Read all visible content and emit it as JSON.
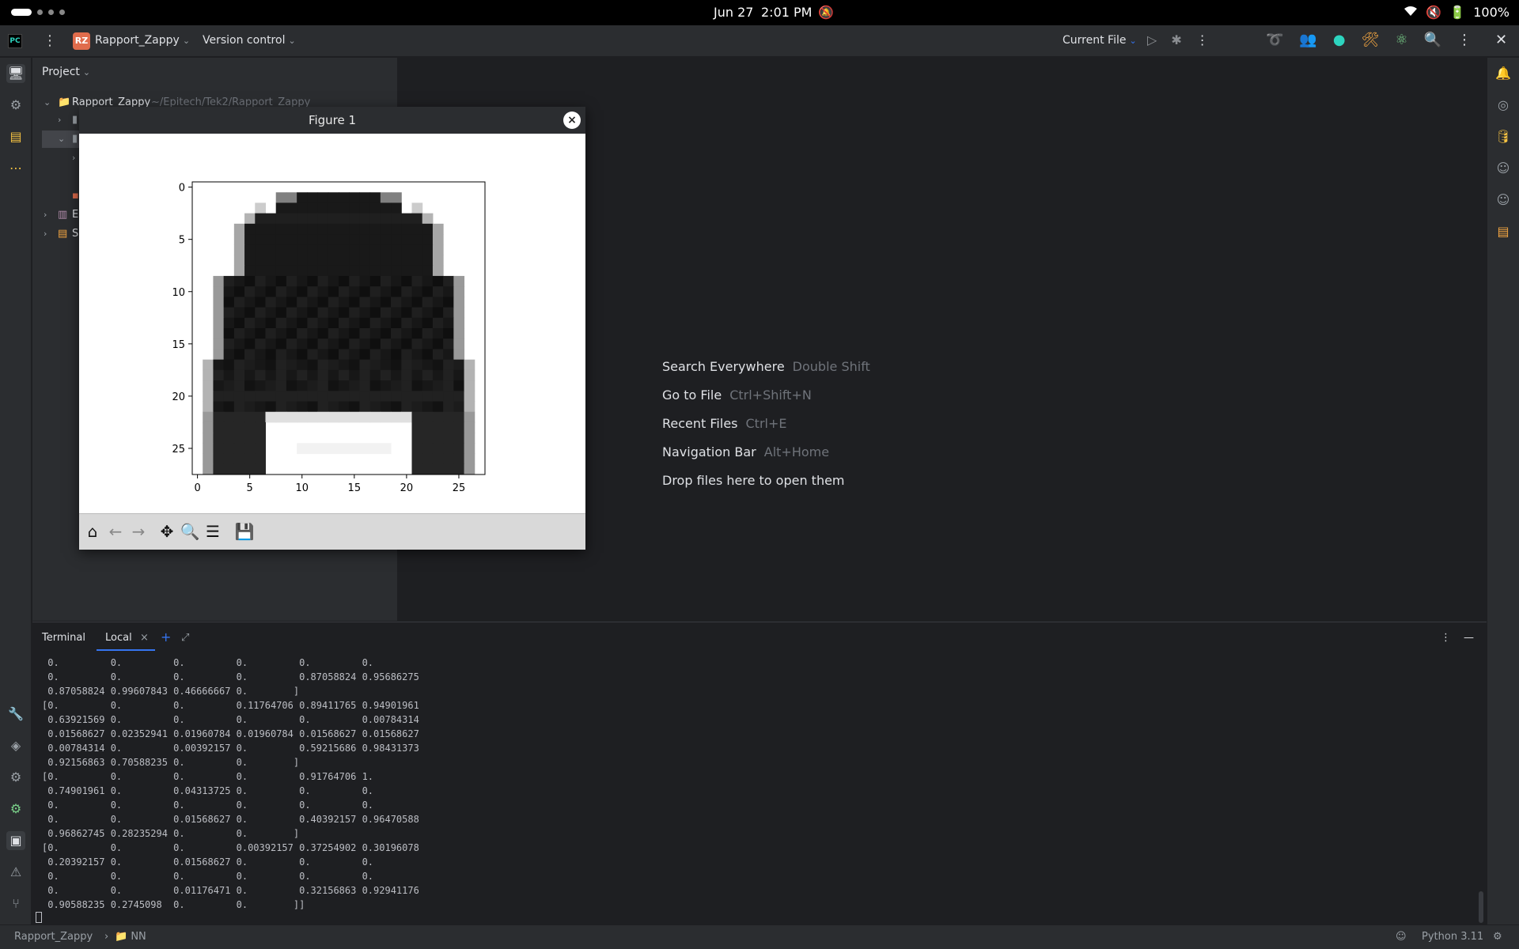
{
  "system": {
    "date": "Jun 27",
    "time": "2:01 PM",
    "battery": "100%"
  },
  "titlebar": {
    "project_badge": "RZ",
    "project_name": "Rapport_Zappy",
    "vcs": "Version control",
    "run_config": "Current File"
  },
  "project_panel": {
    "title": "Project",
    "root_name": "Rapport_Zappy",
    "root_path": "~/Epitech/Tek2/Rapport_Zappy",
    "row_e": "E",
    "row_s": "S"
  },
  "welcome": {
    "items": [
      {
        "label": "Search Everywhere",
        "shortcut": "Double Shift"
      },
      {
        "label": "Go to File",
        "shortcut": "Ctrl+Shift+N"
      },
      {
        "label": "Recent Files",
        "shortcut": "Ctrl+E"
      },
      {
        "label": "Navigation Bar",
        "shortcut": "Alt+Home"
      },
      {
        "label": "Drop files here to open them",
        "shortcut": ""
      }
    ]
  },
  "figure": {
    "title": "Figure 1",
    "close": "×",
    "x_ticks": [
      "0",
      "5",
      "10",
      "15",
      "20",
      "25"
    ],
    "y_ticks": [
      "0",
      "5",
      "10",
      "15",
      "20",
      "25"
    ]
  },
  "chart_data": {
    "type": "heatmap",
    "colormap": "gray_r",
    "x_range": [
      -0.5,
      27.5
    ],
    "y_range": [
      -0.5,
      27.5
    ],
    "x_ticks": [
      0,
      5,
      10,
      15,
      20,
      25
    ],
    "y_ticks": [
      0,
      5,
      10,
      15,
      20,
      25
    ],
    "rows": 28,
    "cols": 28,
    "subject": "grayscale 28x28 image of a long-sleeve pullover"
  },
  "terminal": {
    "title": "Terminal",
    "tab": "Local",
    "lines": [
      " 0.         0.         0.         0.         0.         0.",
      " 0.         0.         0.         0.         0.87058824 0.95686275",
      " 0.87058824 0.99607843 0.46666667 0.        ]",
      "[0.         0.         0.         0.11764706 0.89411765 0.94901961",
      " 0.63921569 0.         0.         0.         0.         0.00784314",
      " 0.01568627 0.02352941 0.01960784 0.01960784 0.01568627 0.01568627",
      " 0.00784314 0.         0.00392157 0.         0.59215686 0.98431373",
      " 0.92156863 0.70588235 0.         0.        ]",
      "[0.         0.         0.         0.         0.91764706 1.",
      " 0.74901961 0.         0.04313725 0.         0.         0.",
      " 0.         0.         0.         0.         0.         0.",
      " 0.         0.         0.01568627 0.         0.40392157 0.96470588",
      " 0.96862745 0.28235294 0.         0.        ]",
      "[0.         0.         0.         0.00392157 0.37254902 0.30196078",
      " 0.20392157 0.         0.01568627 0.         0.         0.",
      " 0.         0.         0.         0.         0.         0.",
      " 0.         0.         0.01176471 0.         0.32156863 0.92941176",
      " 0.90588235 0.2745098  0.         0.        ]]"
    ]
  },
  "statusbar": {
    "crumb1": "Rapport_Zappy",
    "crumb2": "NN",
    "interpreter": "Python 3.11"
  }
}
